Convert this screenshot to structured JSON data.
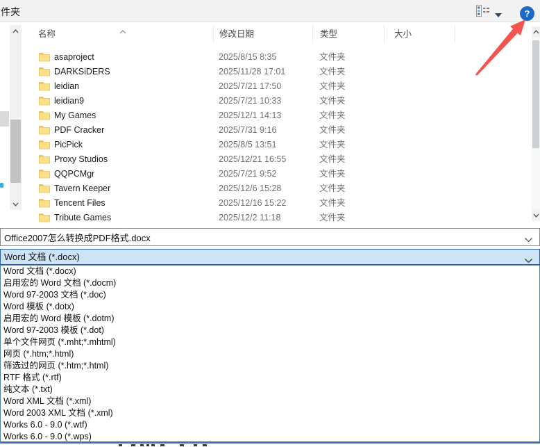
{
  "toolbar": {
    "new_folder_partial": "件夹",
    "help_glyph": "?"
  },
  "file_list": {
    "columns": [
      "名称",
      "修改日期",
      "类型",
      "大小"
    ],
    "sorted_column": "名称",
    "rows": [
      {
        "name": "asaproject",
        "date": "2025/8/15 8:35",
        "type": "文件夹"
      },
      {
        "name": "DARKSiDERS",
        "date": "2025/11/28 17:01",
        "type": "文件夹"
      },
      {
        "name": "leidian",
        "date": "2025/7/21 17:50",
        "type": "文件夹"
      },
      {
        "name": "leidian9",
        "date": "2025/7/21 10:33",
        "type": "文件夹"
      },
      {
        "name": "My Games",
        "date": "2025/12/1 14:13",
        "type": "文件夹"
      },
      {
        "name": "PDF Cracker",
        "date": "2025/7/31 9:16",
        "type": "文件夹"
      },
      {
        "name": "PicPick",
        "date": "2025/8/5 13:51",
        "type": "文件夹"
      },
      {
        "name": "Proxy Studios",
        "date": "2025/12/21 16:55",
        "type": "文件夹"
      },
      {
        "name": "QQPCMgr",
        "date": "2025/7/21 9:52",
        "type": "文件夹"
      },
      {
        "name": "Tavern Keeper",
        "date": "2025/12/6 15:28",
        "type": "文件夹"
      },
      {
        "name": "Tencent Files",
        "date": "2025/12/16 15:22",
        "type": "文件夹"
      },
      {
        "name": "Tribute Games",
        "date": "2025/12/2 11:18",
        "type": "文件夹"
      }
    ]
  },
  "filename": {
    "value": "Office2007怎么转换成PDF格式.docx"
  },
  "filetype": {
    "selected": "Word 文档 (*.docx)",
    "options": [
      "Word 文档 (*.docx)",
      "启用宏的 Word 文档 (*.docm)",
      "Word 97-2003 文档 (*.doc)",
      "Word 模板 (*.dotx)",
      "启用宏的 Word 模板 (*.dotm)",
      "Word 97-2003 模板 (*.dot)",
      "单个文件网页 (*.mht;*.mhtml)",
      "网页 (*.htm;*.html)",
      "筛选过的网页 (*.htm;*.html)",
      "RTF 格式 (*.rtf)",
      "纯文本 (*.txt)",
      "Word XML 文档 (*.xml)",
      "Word 2003 XML 文档 (*.xml)",
      "Works 6.0 - 9.0 (*.wtf)",
      "Works 6.0 - 9.0 (*.wps)"
    ]
  },
  "colors": {
    "accent": "#0078d7",
    "help_blue": "#1b6ac9",
    "arrow_red": "#f2473f",
    "folder_yellow": "#f6d87c",
    "combo_fill": "#cfe3f6",
    "selected_option_text": "#ffffff"
  }
}
